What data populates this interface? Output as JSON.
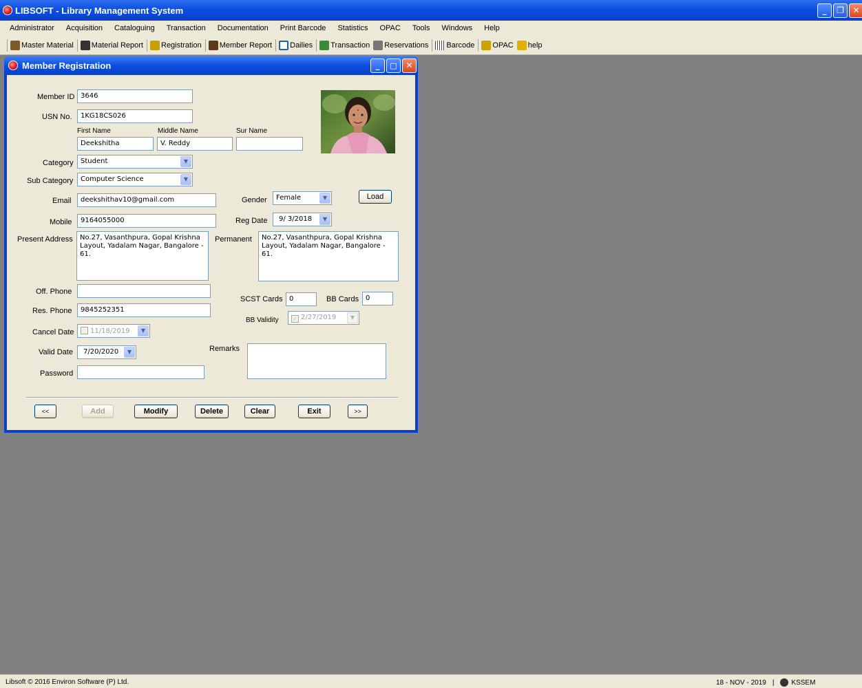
{
  "app": {
    "title": "LIBSOFT - Library Management System",
    "window_buttons": {
      "minimize": "_",
      "restore": "❐",
      "close": "✕"
    }
  },
  "menu": [
    "Administrator",
    "Acquisition",
    "Cataloguing",
    "Transaction",
    "Documentation",
    "Print Barcode",
    "Statistics",
    "OPAC",
    "Tools",
    "Windows",
    "Help"
  ],
  "toolbar": [
    {
      "label": "Master Material",
      "icon": "books-icon",
      "color": "#7a5a2a"
    },
    {
      "label": "Material Report",
      "icon": "binoculars-icon",
      "color": "#333333"
    },
    {
      "label": "Registration",
      "icon": "registration-icon",
      "color": "#c9a000"
    },
    {
      "label": "Member Report",
      "icon": "members-icon",
      "color": "#5a3a1a"
    },
    {
      "label": "Dailies",
      "icon": "notes-icon",
      "color": "#2060c0"
    },
    {
      "label": "Transaction",
      "icon": "transaction-icon",
      "color": "#3a8a3a"
    },
    {
      "label": "Reservations",
      "icon": "reservations-icon",
      "color": "#777777"
    },
    {
      "label": "Barcode",
      "icon": "barcode-icon",
      "color": "#444444"
    },
    {
      "label": "OPAC",
      "icon": "opac-icon",
      "color": "#d0a000"
    },
    {
      "label": "help",
      "icon": "help-icon",
      "color": "#e0b000"
    }
  ],
  "member_window": {
    "title": "Member Registration",
    "labels": {
      "member_id": "Member ID",
      "usn": "USN No.",
      "first_name": "First Name",
      "middle_name": "Middle Name",
      "sur_name": "Sur Name",
      "category": "Category",
      "sub_category": "Sub Category",
      "email": "Email",
      "gender": "Gender",
      "mobile": "Mobile",
      "reg_date": "Reg Date",
      "present_address": "Present Address",
      "permanent": "Permanent",
      "off_phone": "Off. Phone",
      "res_phone": "Res. Phone",
      "scst_cards": "SCST Cards",
      "bb_cards": "BB Cards",
      "bb_validity": "BB Validity",
      "cancel_date": "Cancel Date",
      "valid_date": "Valid Date",
      "remarks": "Remarks",
      "password": "Password"
    },
    "values": {
      "member_id": "3646",
      "usn": "1KG18CS026",
      "first_name": "Deekshitha",
      "middle_name": "V. Reddy",
      "sur_name": "",
      "category": "Student",
      "sub_category": "Computer Science",
      "email": "deekshithav10@gmail.com",
      "gender": "Female",
      "mobile": "9164055000",
      "reg_date": "9/ 3/2018",
      "present_address": "No.27, Vasanthpura, Gopal Krishna Layout, Yadalam Nagar, Bangalore - 61.",
      "permanent_address": "No.27, Vasanthpura, Gopal Krishna Layout, Yadalam Nagar, Bangalore - 61.",
      "off_phone": "",
      "res_phone": "9845252351",
      "scst_cards": "0",
      "bb_cards": "0",
      "bb_validity": "2/27/2019",
      "cancel_date": "11/18/2019",
      "valid_date": "7/20/2020",
      "remarks": "",
      "password": ""
    },
    "buttons": {
      "load": "Load",
      "prev": "<<",
      "add": "Add",
      "modify": "Modify",
      "delete": "Delete",
      "clear": "Clear",
      "exit": "Exit",
      "next": ">>"
    }
  },
  "status": {
    "copyright": "Libsoft © 2016  Environ Software (P) Ltd.",
    "date": "18 - NOV - 2019",
    "separator": "|",
    "user": "KSSEM"
  },
  "colors": {
    "titlebar": "#0a4fe0",
    "desktop": "#808080",
    "panel": "#ece9d8"
  }
}
